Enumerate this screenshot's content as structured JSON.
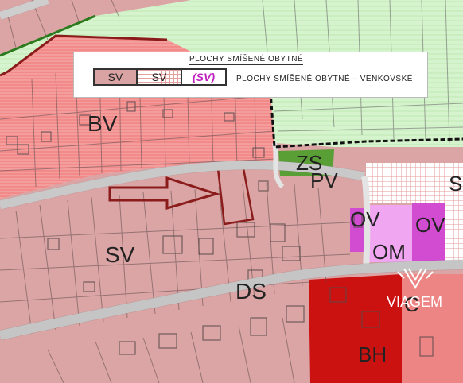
{
  "legend": {
    "title": "PLOCHY SMÍŠENÉ OBYTNÉ",
    "swatch_existing": "SV",
    "swatch_proposed": "SV",
    "swatch_reserve": "(SV)",
    "description": "PLOCHY SMÍŠENÉ OBYTNÉ – VENKOVSKÉ"
  },
  "zones": {
    "bv": "BV",
    "sv": "SV",
    "zs": "ZS",
    "pv": "PV",
    "ds": "DS",
    "ov_left": "OV",
    "ov_right": "OV",
    "om": "OM",
    "bh": "BH",
    "s_edge": "S",
    "partial": "C"
  },
  "watermark": {
    "text": "VIAGEM",
    "icon": "viagem-logo-icon"
  },
  "colors": {
    "residential_red": "#ef7e7e",
    "mixed_village_pink": "#d9a3a3",
    "greenery": "#d2f2c8",
    "dark_green": "#4f9a2e",
    "civic_magenta": "#e884e8",
    "high_density_red": "#cc1111",
    "road": "#e4e4e4",
    "arrow": "#8b1c1c"
  }
}
